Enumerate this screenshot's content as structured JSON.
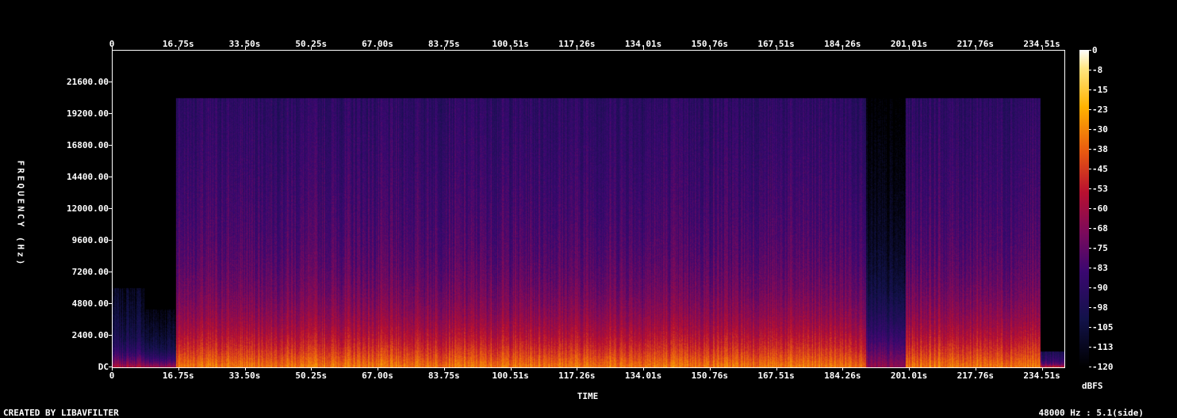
{
  "chart_data": {
    "type": "heatmap",
    "title": "",
    "xlabel": "TIME",
    "ylabel": "FREQUENCY (Hz)",
    "x_ticks": [
      "0",
      "16.75s",
      "33.50s",
      "50.25s",
      "67.00s",
      "83.75s",
      "100.51s",
      "117.26s",
      "134.01s",
      "150.76s",
      "167.51s",
      "184.26s",
      "201.01s",
      "217.76s",
      "234.51s"
    ],
    "x_tick_values": [
      0,
      16.75,
      33.5,
      50.25,
      67.0,
      83.75,
      100.51,
      117.26,
      134.01,
      150.76,
      167.51,
      184.26,
      201.01,
      217.76,
      234.51
    ],
    "xlim": [
      0,
      240
    ],
    "y_ticks": [
      "DC",
      "2400.00",
      "4800.00",
      "7200.00",
      "9600.00",
      "12000.00",
      "14400.00",
      "16800.00",
      "19200.00",
      "21600.00"
    ],
    "y_tick_values": [
      0,
      2400,
      4800,
      7200,
      9600,
      12000,
      14400,
      16800,
      19200,
      21600
    ],
    "ylim": [
      0,
      24000
    ],
    "colorbar_label": "dBFS",
    "colorbar_ticks": [
      "0",
      "-8",
      "-15",
      "-23",
      "-30",
      "-38",
      "-45",
      "-53",
      "-60",
      "-68",
      "-75",
      "-83",
      "-90",
      "-98",
      "-105",
      "-113",
      "-120"
    ],
    "colorbar_range": [
      -120,
      0
    ],
    "regions": [
      {
        "t": [
          0,
          8
        ],
        "fmax": 6000,
        "level": -95
      },
      {
        "t": [
          8,
          16
        ],
        "fmax": 4400,
        "level": -98
      },
      {
        "t": [
          16,
          190
        ],
        "fmax": 20400,
        "level": -72
      },
      {
        "t": [
          190,
          200
        ],
        "fmax": 20400,
        "level": -105
      },
      {
        "t": [
          200,
          234
        ],
        "fmax": 20400,
        "level": -72
      },
      {
        "t": [
          234,
          240
        ],
        "fmax": 1200,
        "level": -80
      }
    ]
  },
  "footer": {
    "left": "CREATED BY LIBAVFILTER",
    "right": "48000 Hz : 5.1(side)"
  }
}
